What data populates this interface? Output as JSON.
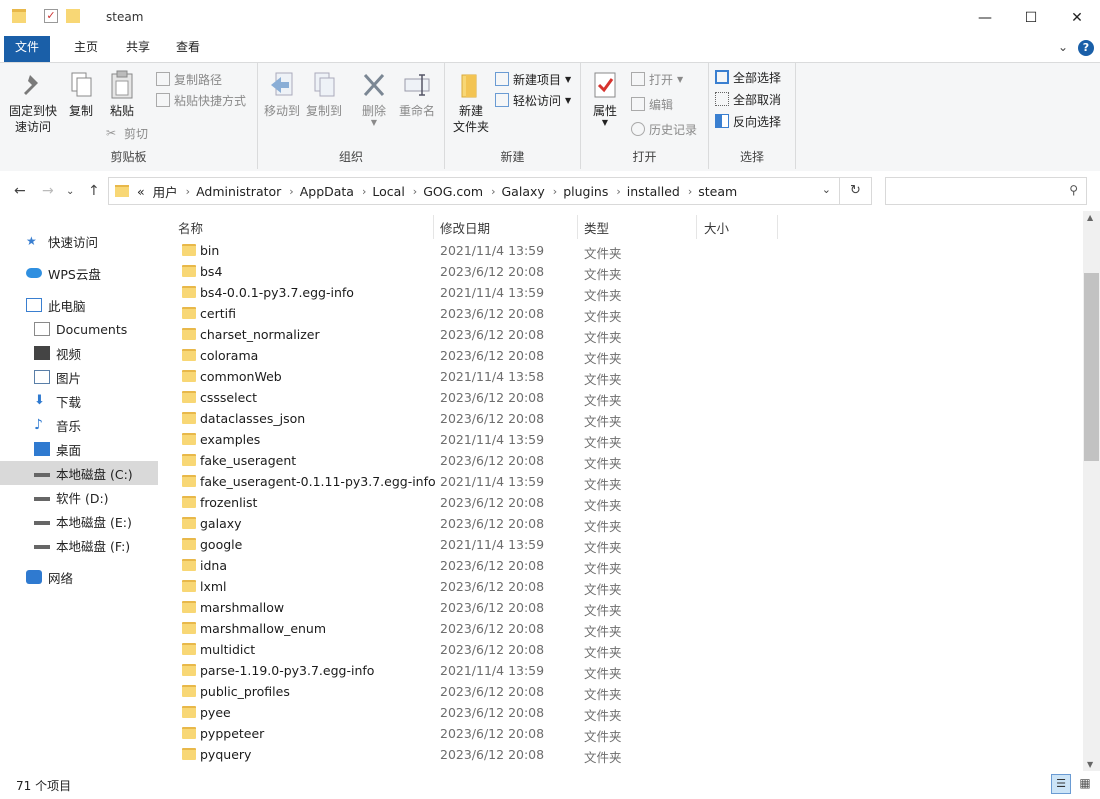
{
  "titlebar": {
    "title": "steam",
    "minimize": "—",
    "maximize": "☐",
    "close": "✕"
  },
  "tabs": [
    {
      "label": "文件",
      "active": true
    },
    {
      "label": "主页"
    },
    {
      "label": "共享"
    },
    {
      "label": "查看"
    }
  ],
  "ribbon": {
    "clipboard": {
      "label": "剪贴板",
      "pin": "固定到快",
      "pin2": "速访问",
      "copy": "复制",
      "paste": "粘贴",
      "copy_path": "复制路径",
      "paste_shortcut": "粘贴快捷方式",
      "cut": "剪切"
    },
    "organize": {
      "label": "组织",
      "move_to": "移动到",
      "copy_to": "复制到",
      "delete": "删除",
      "rename": "重命名"
    },
    "new": {
      "label": "新建",
      "new_folder": "新建",
      "new_folder2": "文件夹",
      "new_item": "新建项目",
      "easy_access": "轻松访问"
    },
    "open": {
      "label": "打开",
      "properties": "属性",
      "open": "打开",
      "edit": "编辑",
      "history": "历史记录"
    },
    "select": {
      "label": "选择",
      "select_all": "全部选择",
      "select_none": "全部取消",
      "invert": "反向选择"
    },
    "help_icon": "?"
  },
  "address": {
    "prefix": "«",
    "crumbs": [
      "用户",
      "Administrator",
      "AppData",
      "Local",
      "GOG.com",
      "Galaxy",
      "plugins",
      "installed",
      "steam"
    ],
    "refresh": "↻",
    "search_placeholder": ""
  },
  "navpane": {
    "items": [
      {
        "label": "快速访问",
        "icon": "star-icon"
      },
      {
        "label": "WPS云盘",
        "icon": "cloud-icon"
      },
      {
        "label": "此电脑",
        "icon": "computer-icon"
      },
      {
        "label": "Documents",
        "icon": "document-icon"
      },
      {
        "label": "视频",
        "icon": "video-icon"
      },
      {
        "label": "图片",
        "icon": "picture-icon"
      },
      {
        "label": "下载",
        "icon": "download-icon"
      },
      {
        "label": "音乐",
        "icon": "music-icon"
      },
      {
        "label": "桌面",
        "icon": "desktop-icon"
      },
      {
        "label": "本地磁盘 (C:)",
        "icon": "drive-icon",
        "selected": true
      },
      {
        "label": "软件 (D:)",
        "icon": "drive-icon"
      },
      {
        "label": "本地磁盘 (E:)",
        "icon": "drive-icon"
      },
      {
        "label": "本地磁盘 (F:)",
        "icon": "drive-icon"
      },
      {
        "label": "网络",
        "icon": "network-icon"
      }
    ]
  },
  "columns": {
    "name": "名称",
    "date": "修改日期",
    "type": "类型",
    "size": "大小"
  },
  "files": [
    {
      "name": "bin",
      "date": "2021/11/4 13:59",
      "type": "文件夹"
    },
    {
      "name": "bs4",
      "date": "2023/6/12 20:08",
      "type": "文件夹"
    },
    {
      "name": "bs4-0.0.1-py3.7.egg-info",
      "date": "2021/11/4 13:59",
      "type": "文件夹"
    },
    {
      "name": "certifi",
      "date": "2023/6/12 20:08",
      "type": "文件夹"
    },
    {
      "name": "charset_normalizer",
      "date": "2023/6/12 20:08",
      "type": "文件夹"
    },
    {
      "name": "colorama",
      "date": "2023/6/12 20:08",
      "type": "文件夹"
    },
    {
      "name": "commonWeb",
      "date": "2021/11/4 13:58",
      "type": "文件夹"
    },
    {
      "name": "cssselect",
      "date": "2023/6/12 20:08",
      "type": "文件夹"
    },
    {
      "name": "dataclasses_json",
      "date": "2023/6/12 20:08",
      "type": "文件夹"
    },
    {
      "name": "examples",
      "date": "2021/11/4 13:59",
      "type": "文件夹"
    },
    {
      "name": "fake_useragent",
      "date": "2023/6/12 20:08",
      "type": "文件夹"
    },
    {
      "name": "fake_useragent-0.1.11-py3.7.egg-info",
      "date": "2021/11/4 13:59",
      "type": "文件夹"
    },
    {
      "name": "frozenlist",
      "date": "2023/6/12 20:08",
      "type": "文件夹"
    },
    {
      "name": "galaxy",
      "date": "2023/6/12 20:08",
      "type": "文件夹"
    },
    {
      "name": "google",
      "date": "2021/11/4 13:59",
      "type": "文件夹"
    },
    {
      "name": "idna",
      "date": "2023/6/12 20:08",
      "type": "文件夹"
    },
    {
      "name": "lxml",
      "date": "2023/6/12 20:08",
      "type": "文件夹"
    },
    {
      "name": "marshmallow",
      "date": "2023/6/12 20:08",
      "type": "文件夹"
    },
    {
      "name": "marshmallow_enum",
      "date": "2023/6/12 20:08",
      "type": "文件夹"
    },
    {
      "name": "multidict",
      "date": "2023/6/12 20:08",
      "type": "文件夹"
    },
    {
      "name": "parse-1.19.0-py3.7.egg-info",
      "date": "2021/11/4 13:59",
      "type": "文件夹"
    },
    {
      "name": "public_profiles",
      "date": "2023/6/12 20:08",
      "type": "文件夹"
    },
    {
      "name": "pyee",
      "date": "2023/6/12 20:08",
      "type": "文件夹"
    },
    {
      "name": "pyppeteer",
      "date": "2023/6/12 20:08",
      "type": "文件夹"
    },
    {
      "name": "pyquery",
      "date": "2023/6/12 20:08",
      "type": "文件夹"
    }
  ],
  "status": {
    "count": "71 个项目"
  },
  "colors": {
    "accent": "#1a5fa8",
    "folder": "#f8d775",
    "selected_nav": "#d9d9d9"
  }
}
